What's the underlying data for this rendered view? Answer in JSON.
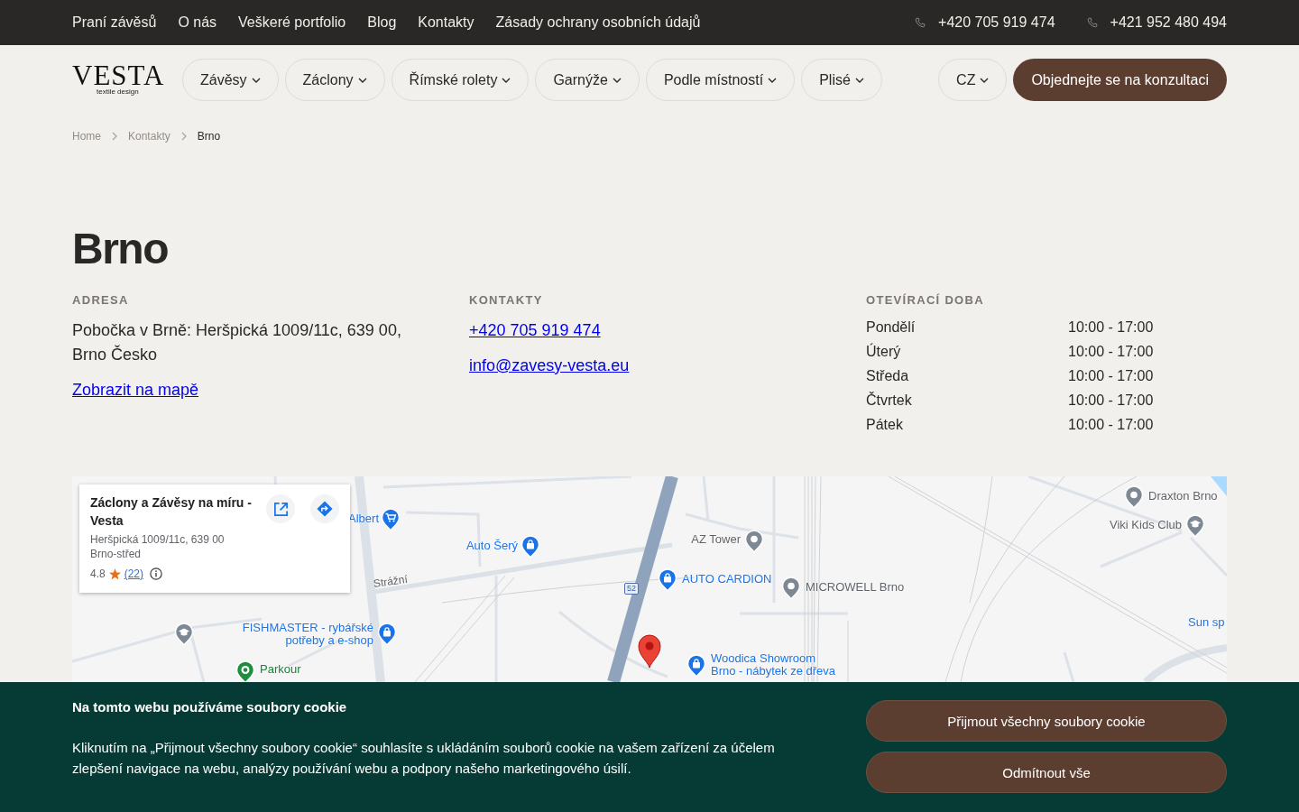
{
  "top_bar": {
    "links": [
      "Praní závěsů",
      "O nás",
      "Veškeré portfolio",
      "Blog",
      "Kontakty",
      "Zásady ochrany osobních údajů"
    ],
    "phones": [
      "+420 705 919 474",
      "+421 952 480 494"
    ]
  },
  "header": {
    "logo": {
      "wordmark": "VESTA",
      "tagline": "textile design"
    },
    "menu": [
      "Závěsy",
      "Záclony",
      "Římské rolety",
      "Garnýže",
      "Podle místností",
      "Plisé"
    ],
    "language": "CZ",
    "cta": "Objednejte se na konzultaci"
  },
  "breadcrumb": [
    {
      "label": "Home",
      "current": false
    },
    {
      "label": "Kontakty",
      "current": false
    },
    {
      "label": "Brno",
      "current": true
    }
  ],
  "page_title": "Brno",
  "address": {
    "heading": "ADRESA",
    "text": "Pobočka v Brně: Heršpická 1009/11c, 639 00, Brno Česko",
    "map_link": "Zobrazit na mapě"
  },
  "contacts": {
    "heading": "KONTAKTY",
    "phone": "+420 705 919 474",
    "email": "info@zavesy-vesta.eu"
  },
  "opening_hours": {
    "heading": "OTEVÍRACÍ DOBA",
    "days": [
      {
        "day": "Pondělí",
        "hours": "10:00 - 17:00"
      },
      {
        "day": "Úterý",
        "hours": "10:00 - 17:00"
      },
      {
        "day": "Středa",
        "hours": "10:00 - 17:00"
      },
      {
        "day": "Čtvrtek",
        "hours": "10:00 - 17:00"
      },
      {
        "day": "Pátek",
        "hours": "10:00 - 17:00"
      }
    ]
  },
  "map": {
    "place_card": {
      "name": "Záclony a Závěsy na míru - Vesta",
      "address": "Heršpická 1009/11c, 639 00 Brno-střed",
      "rating": "4.8",
      "reviews": "(22)"
    },
    "places": [
      {
        "label": "Albert",
        "kind": "grocery"
      },
      {
        "label": "Auto Šerý",
        "kind": "shop"
      },
      {
        "label": "FISHMASTER - rybářské potřeby a e-shop",
        "kind": "shop"
      },
      {
        "label": "Parkour",
        "kind": "park"
      },
      {
        "label": "AZ Tower",
        "kind": "generic"
      },
      {
        "label": "AUTO CARDION",
        "kind": "shop"
      },
      {
        "label": "MICROWELL Brno",
        "kind": "generic"
      },
      {
        "label": "Woodica Showroom Brno - nábytek ze dřeva",
        "kind": "shop"
      },
      {
        "label": "Draxton Brno",
        "kind": "generic"
      },
      {
        "label": "Viki Kids Club",
        "kind": "education"
      },
      {
        "label": "Sun sp",
        "kind": "shop"
      }
    ],
    "streets": [
      "Strážní"
    ],
    "route_number": "52"
  },
  "cookie_banner": {
    "title": "Na tomto webu používáme soubory cookie",
    "text": "Kliknutím na „Přijmout všechny soubory cookie“ souhlasíte s ukládáním souborů cookie na vašem zařízení za účelem zlepšení navigace na webu, analýzy používání webu a podpory našeho marketingového úsilí.",
    "buttons": [
      "Přijmout všechny soubory cookie",
      "Odmítnout vše"
    ]
  }
}
